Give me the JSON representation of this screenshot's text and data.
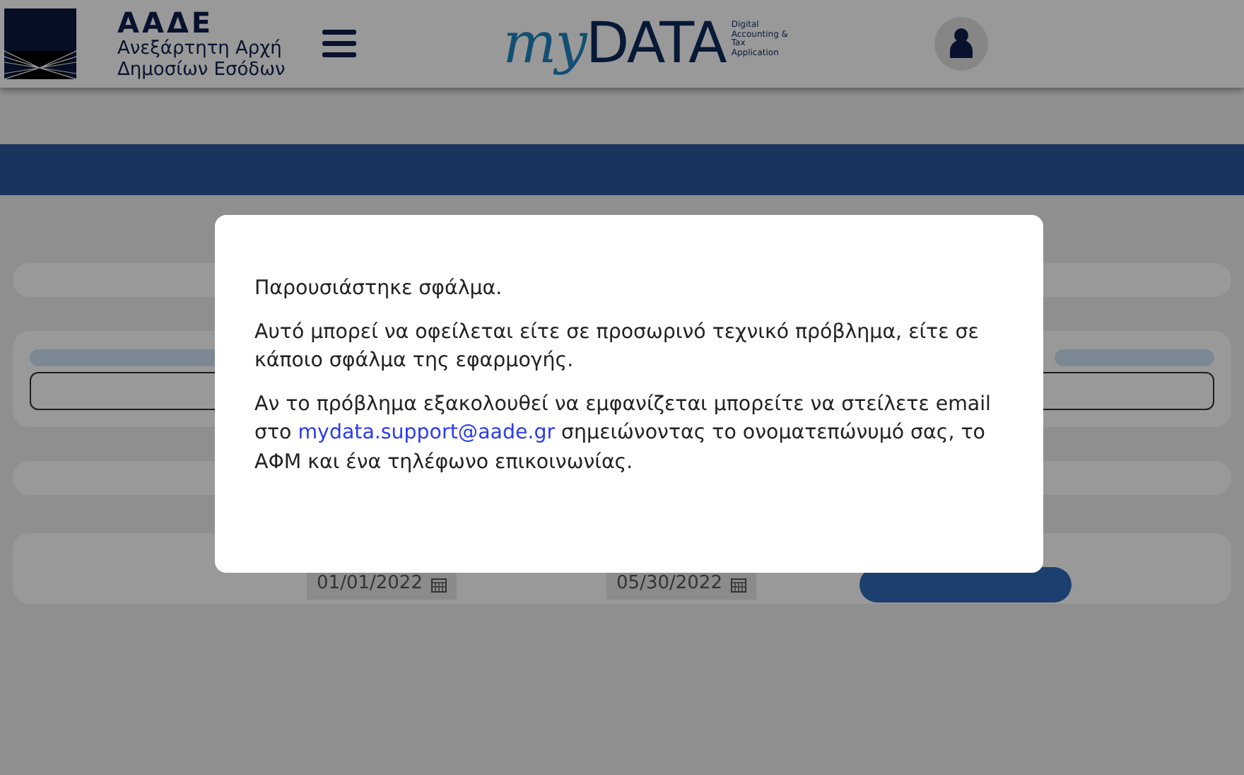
{
  "header": {
    "org_short": "ΑΑΔΕ",
    "org_name": [
      "Ανεξάρτητη Αρχή",
      "Δημοσίων Εσόδων"
    ],
    "app_name": {
      "prefix": "my",
      "main": "DATA"
    },
    "app_tagline": [
      "Digital",
      "Accounting &",
      "Tax",
      "Application"
    ]
  },
  "filters": {
    "dates": [
      "01/01/2022",
      "05/30/2022"
    ]
  },
  "modal": {
    "paragraphs": [
      {
        "text": "Παρουσιάστηκε σφάλμα."
      },
      {
        "text": "Αυτό μπορεί να οφείλεται είτε σε προσωρινό τεχνικό πρόβλημα, είτε σε κάποιο σφάλμα της εφαρμογής."
      },
      {
        "text": "Αν το πρόβλημα εξακολουθεί να εμφανίζεται μπορείτε να στείλετε email στο ",
        "link": "mydata.support@aade.gr",
        "after": " σημειώνοντας το ονοματεπώνυμό σας, το ΑΦΜ και ένα τηλέφωνο επικοινωνίας."
      }
    ]
  }
}
